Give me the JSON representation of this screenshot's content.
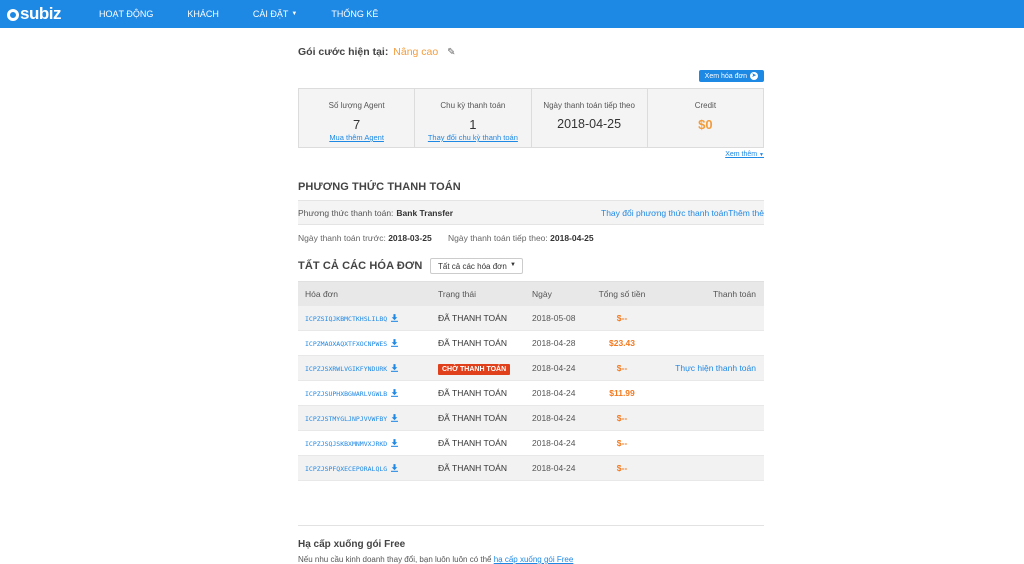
{
  "nav": {
    "logo": "subiz",
    "items": [
      "HOẠT ĐỘNG",
      "KHÁCH",
      "CÀI ĐẶT",
      "THỐNG KÊ"
    ]
  },
  "plan": {
    "label": "Gói cước hiện tại:",
    "name": "Nâng cao",
    "view_invoice_btn": "Xem hóa đơn"
  },
  "stats": [
    {
      "label": "Số lượng Agent",
      "value": "7",
      "link": "Mua thêm Agent"
    },
    {
      "label": "Chu kỳ thanh toán",
      "value": "1",
      "link": "Thay đổi chu kỳ thanh toán"
    },
    {
      "label": "Ngày thanh toán tiếp theo",
      "value": "2018-04-25",
      "link": ""
    },
    {
      "label": "Credit",
      "value": "$0",
      "link": ""
    }
  ],
  "more_link": "Xem thêm",
  "payment_method": {
    "title": "PHƯƠNG THỨC THANH TOÁN",
    "label": "Phương thức thanh toán:",
    "value": "Bank Transfer",
    "change_link": "Thay đổi phương thức thanh toán",
    "add_link": "Thêm thẻ",
    "prev_label": "Ngày thanh toán trước:",
    "prev_date": "2018-03-25",
    "next_label": "Ngày thanh toán tiếp theo:",
    "next_date": "2018-04-25"
  },
  "invoices": {
    "title": "TẤT CẢ CÁC HÓA ĐƠN",
    "filter": "Tất cả các hóa đơn",
    "columns": [
      "Hóa đơn",
      "Trạng thái",
      "Ngày",
      "Tổng số tiền",
      "Thanh toán"
    ],
    "rows": [
      {
        "code": "ICPZSIQJKBMCTKHSLILBQ",
        "status": "ĐÃ THANH TOÁN",
        "pending": false,
        "date": "2018-05-08",
        "amount": "$--",
        "pay": ""
      },
      {
        "code": "ICPZMAOXAQXTFXOCNPWES",
        "status": "ĐÃ THANH TOÁN",
        "pending": false,
        "date": "2018-04-28",
        "amount": "$23.43",
        "pay": ""
      },
      {
        "code": "ICPZJSXRWLVGIKFYNDURK",
        "status": "CHỜ THANH TOÁN",
        "pending": true,
        "date": "2018-04-24",
        "amount": "$--",
        "pay": "Thực hiện thanh toán"
      },
      {
        "code": "ICPZJSUPHXBGWARLVGWLB",
        "status": "ĐÃ THANH TOÁN",
        "pending": false,
        "date": "2018-04-24",
        "amount": "$11.99",
        "pay": ""
      },
      {
        "code": "ICPZJSTMYGLJNPJVVWFBY",
        "status": "ĐÃ THANH TOÁN",
        "pending": false,
        "date": "2018-04-24",
        "amount": "$--",
        "pay": ""
      },
      {
        "code": "ICPZJSQJSKBXMNMVXJRKD",
        "status": "ĐÃ THANH TOÁN",
        "pending": false,
        "date": "2018-04-24",
        "amount": "$--",
        "pay": ""
      },
      {
        "code": "ICPZJSPFQXECEPORALQLG",
        "status": "ĐÃ THANH TOÁN",
        "pending": false,
        "date": "2018-04-24",
        "amount": "$--",
        "pay": ""
      }
    ]
  },
  "downgrade": {
    "title": "Hạ cấp xuống gói Free",
    "text": "Nếu nhu cầu kinh doanh thay đổi, bạn luôn luôn có thể",
    "link": "hạ cấp xuống gói Free"
  },
  "colors": {
    "primary": "#1e88e5",
    "accent": "#f39c3c",
    "pending_badge": "#e0401b"
  }
}
